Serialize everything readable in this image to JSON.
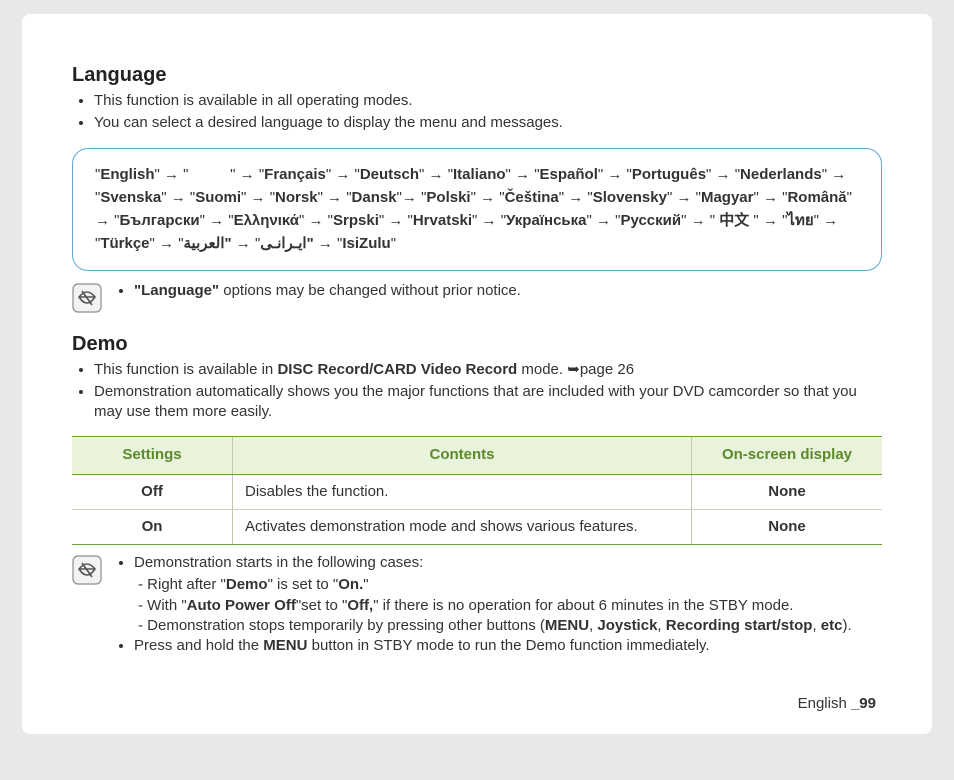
{
  "language": {
    "heading": "Language",
    "bullets": [
      "This function is available in all operating modes.",
      "You can select a desired language to display the menu and messages."
    ],
    "langbox_html": "\"<b>English</b>\" → \"&nbsp;&nbsp;&nbsp;&nbsp;&nbsp;&nbsp;&nbsp;&nbsp;&nbsp;&nbsp;\" → \"<b>Français</b>\" → \"<b>Deutsch</b>\" → \"<b>Italiano</b>\" → \"<b>Español</b>\" → \"<b>Português</b>\" → \"<b>Nederlands</b>\" → \"<b>Svenska</b>\" → \"<b>Suomi</b>\" → \"<b>Norsk</b>\" → \"<b>Dansk</b>\"→ \"<b>Polski</b>\" → \"<b>Čeština</b>\" → \"<b>Slovensky</b>\" → \"<b>Magyar</b>\" → \"<b>Română</b>\" → \"<b>Български</b>\" → \"<b>Ελληνικά</b>\" → \"<b>Srpski</b>\" → \"<b>Hrvatski</b>\" → \"<b>Українська</b>\" → \"<b>Русский</b>\" → \" <b>中文</b> \" → \"<b>ไทย</b>\" → \"<b>Türkçe</b>\" → \"<b>ایـرانـی</b>\" → <b>\"العربية\"</b> → \"<b>IsiZulu</b>\"",
    "note_html": "<b>\"Language\"</b> options may be changed without prior notice."
  },
  "demo": {
    "heading": "Demo",
    "bullets_html": [
      "This function is available in <b>DISC Record/CARD Video Record</b> mode. <span class=\"crossref\"></span>page 26",
      "Demonstration automatically shows you the major functions that are included with your DVD camcorder so that you may use them more easily."
    ],
    "table": {
      "headers": [
        "Settings",
        "Contents",
        "On-screen display"
      ],
      "rows": [
        {
          "setting": "Off",
          "content": "Disables the function.",
          "osd": "None"
        },
        {
          "setting": "On",
          "content": "Activates demonstration mode and shows various features.",
          "osd": "None"
        }
      ]
    },
    "note": {
      "top_html": [
        "Demonstration starts in the following cases:",
        "Press and hold the <b>MENU</b> button in STBY mode to run the Demo function immediately."
      ],
      "dashes_html": [
        "Right after \"<b>Demo</b>\" is set to \"<b>On.</b>\"",
        "With \"<b>Auto Power Off</b>\"set to \"<b>Off,</b>\" if there is no operation for about 6 minutes in the STBY mode.",
        "Demonstration stops temporarily by pressing other buttons (<b>MENU</b>, <b>Joystick</b>, <b>Recording start/stop</b>, <b>etc</b>)."
      ]
    }
  },
  "footer": {
    "lang": "English ",
    "page": "_99"
  }
}
